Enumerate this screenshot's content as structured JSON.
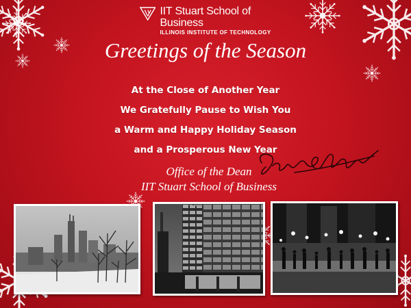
{
  "logo": {
    "title": "IIT Stuart School of Business",
    "subtitle": "ILLINOIS INSTITUTE OF TECHNOLOGY"
  },
  "greeting": "Greetings of the Season",
  "message": [
    "At the Close of Another Year",
    "We Gratefully Pause to Wish You",
    "a Warm and Happy Holiday Season",
    "and a Prosperous New Year"
  ],
  "signature_block": {
    "line1": "Office of the Dean",
    "line2": "IIT Stuart School of Business"
  },
  "colors": {
    "background": "#c3141f",
    "text": "#ffffff"
  },
  "photos": [
    {
      "subject": "grayscale photo of the Chicago skyline in winter"
    },
    {
      "subject": "grayscale photo of a campus office building"
    },
    {
      "subject": "grayscale photo of a skating rink at night"
    }
  ],
  "icons": [
    "snowflake-icon",
    "iit-logo-icon",
    "handwritten-signature"
  ]
}
